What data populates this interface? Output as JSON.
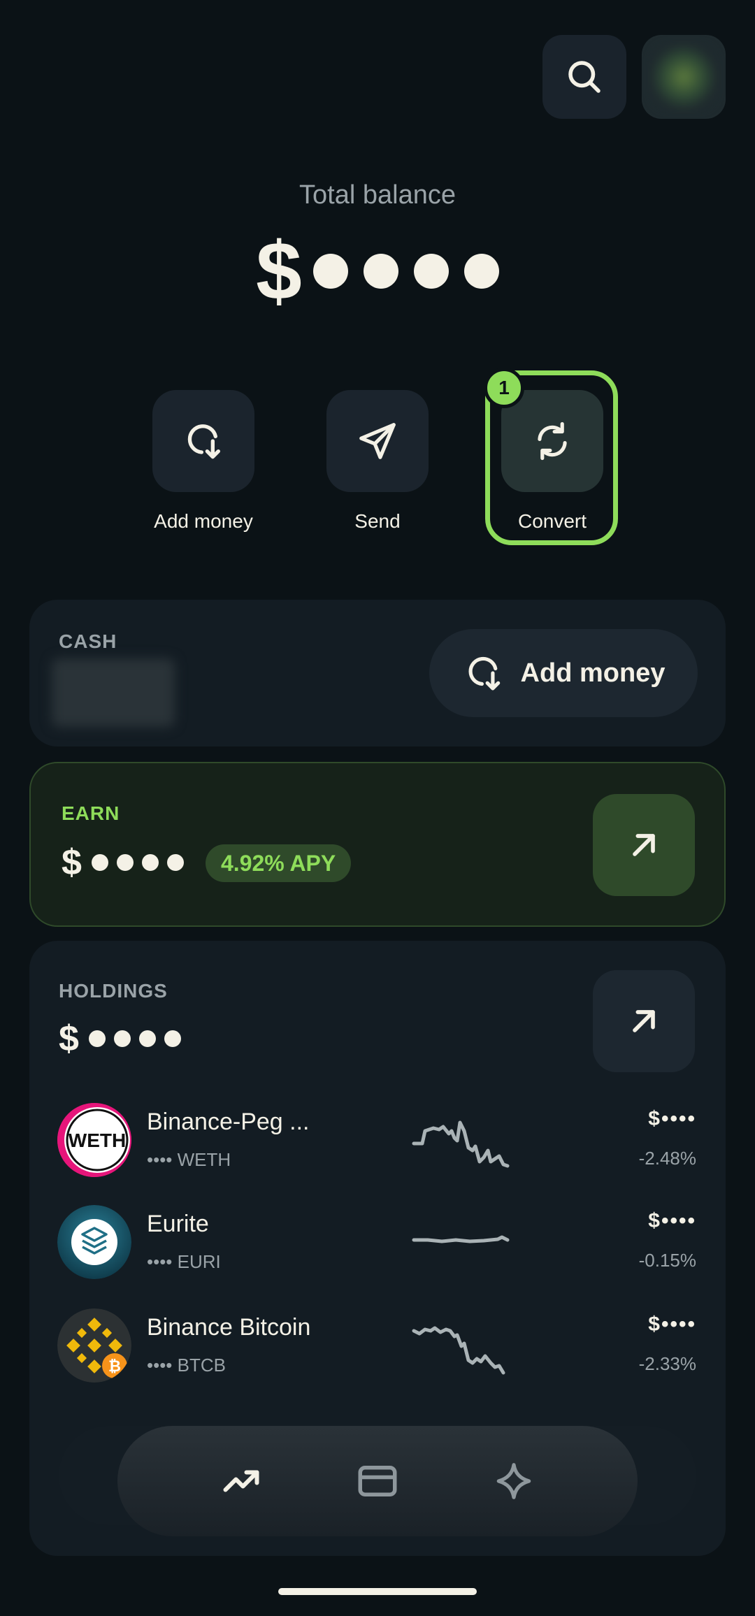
{
  "header": {
    "search_icon": "search-icon",
    "avatar": "blurred avatar"
  },
  "balance": {
    "label": "Total balance",
    "currency": "$",
    "hidden_dots": 4
  },
  "actions": [
    {
      "label": "Add money",
      "icon": "add-money-icon"
    },
    {
      "label": "Send",
      "icon": "send-icon"
    },
    {
      "label": "Convert",
      "icon": "convert-icon",
      "badge": "1",
      "highlighted": true
    }
  ],
  "cash": {
    "label": "CASH",
    "button_label": "Add money"
  },
  "earn": {
    "label": "EARN",
    "currency": "$",
    "apy": "4.92% APY"
  },
  "holdings": {
    "label": "HOLDINGS",
    "currency": "$",
    "items": [
      {
        "name": "Binance-Peg ...",
        "sub": "•••• WETH",
        "value": "$••••",
        "change": "-2.48%",
        "logo_text": "WETH"
      },
      {
        "name": "Eurite",
        "sub": "•••• EURI",
        "value": "$••••",
        "change": "-0.15%"
      },
      {
        "name": "Binance Bitcoin",
        "sub": "•••• BTCB",
        "value": "$••••",
        "change": "-2.33%"
      }
    ]
  },
  "colors": {
    "background": "#0b1216",
    "accent_green": "#8edc5a",
    "card": "#131c23",
    "muted_text": "#9aa3a8"
  },
  "nav": {
    "items": [
      "trending-icon",
      "card-icon",
      "sparkle-icon"
    ]
  }
}
